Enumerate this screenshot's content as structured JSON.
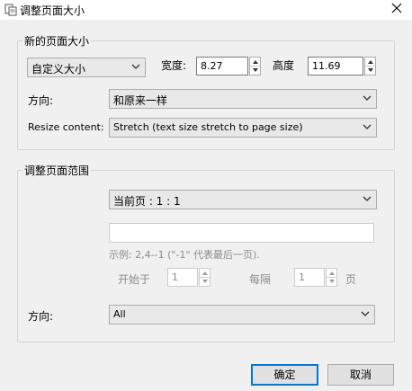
{
  "window": {
    "title": "调整页面大小"
  },
  "new_size": {
    "legend": "新的页面大小",
    "preset": "自定义大小",
    "width_label": "宽度:",
    "width_value": "8.27",
    "height_label": "高度",
    "height_value": "11.69",
    "orientation_label": "方向:",
    "orientation_value": "和原来一样",
    "resize_label": "Resize content:",
    "resize_value": "Stretch (text size stretch to page size)"
  },
  "range": {
    "legend": "调整页面范围",
    "selection": "当前页 : 1 : 1",
    "pages_input": "",
    "example": "示例: 2,4--1 (\"-1\" 代表最后一页).",
    "start_label": "开始于",
    "start_value": "1",
    "every_label": "每隔",
    "every_value": "1",
    "page_unit": "页",
    "orientation_label": "方向:",
    "orientation_value": "All"
  },
  "buttons": {
    "ok": "确定",
    "cancel": "取消"
  },
  "colors": {
    "accent": "#0078d7"
  }
}
